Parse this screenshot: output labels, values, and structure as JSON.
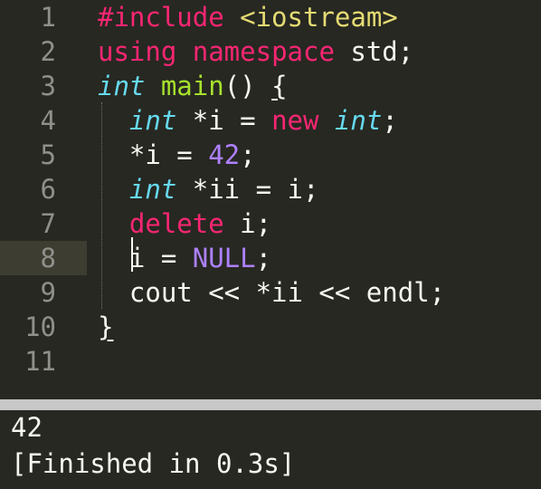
{
  "editor": {
    "current_line": 8,
    "lines": [
      {
        "n": "1",
        "tokens": [
          [
            "#include ",
            "pink"
          ],
          [
            "<iostream>",
            "yellow"
          ]
        ]
      },
      {
        "n": "2",
        "tokens": [
          [
            "using ",
            "pink"
          ],
          [
            "namespace ",
            "pink"
          ],
          [
            "std;",
            "white"
          ]
        ]
      },
      {
        "n": "3",
        "tokens": [
          [
            "int ",
            "cyan"
          ],
          [
            "main",
            "green"
          ],
          [
            "() ",
            "white"
          ],
          [
            "{",
            "white brace-u"
          ]
        ]
      },
      {
        "n": "4",
        "tokens": [
          [
            "  ",
            "white"
          ],
          [
            "int ",
            "cyan"
          ],
          [
            "*i = ",
            "white"
          ],
          [
            "new ",
            "pink"
          ],
          [
            "int",
            "cyan"
          ],
          [
            ";",
            "white"
          ]
        ]
      },
      {
        "n": "5",
        "tokens": [
          [
            "  *i = ",
            "white"
          ],
          [
            "42",
            "purple"
          ],
          [
            ";",
            "white"
          ]
        ]
      },
      {
        "n": "6",
        "tokens": [
          [
            "  ",
            "white"
          ],
          [
            "int ",
            "cyan"
          ],
          [
            "*ii = i;",
            "white"
          ]
        ]
      },
      {
        "n": "7",
        "tokens": [
          [
            "  ",
            "white"
          ],
          [
            "delete ",
            "pink"
          ],
          [
            "i;",
            "white"
          ]
        ]
      },
      {
        "n": "8",
        "tokens": [
          [
            "  i = ",
            "white"
          ],
          [
            "NULL",
            "purple"
          ],
          [
            ";",
            "white"
          ]
        ]
      },
      {
        "n": "9",
        "tokens": [
          [
            "  cout << *ii << endl;",
            "white"
          ]
        ]
      },
      {
        "n": "10",
        "tokens": [
          [
            "}",
            "white brace-u"
          ]
        ]
      },
      {
        "n": "11",
        "tokens": []
      }
    ]
  },
  "console": {
    "output_line": "42",
    "finished_line": "[Finished in 0.3s]"
  },
  "colors": {
    "background": "#272822",
    "keyword": "#f92672",
    "string": "#e6db74",
    "type": "#66d9ef",
    "function": "#a6e22e",
    "constant": "#ae81ff",
    "line_number": "#8f908a",
    "divider": "#c8c8c8"
  }
}
